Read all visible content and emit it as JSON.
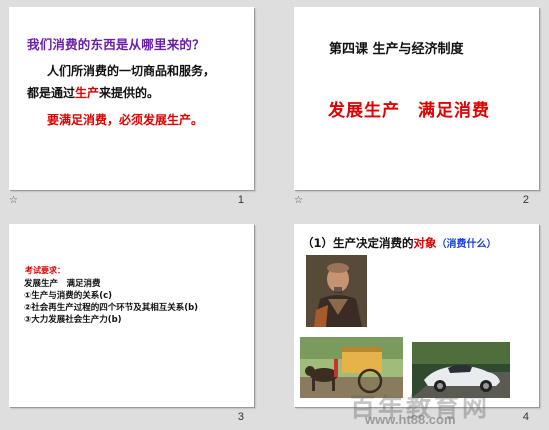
{
  "slides": [
    {
      "number": "1",
      "question": "我们消费的东西是从哪里来的？",
      "para1": "人们所消费的一切商品和服务，",
      "para2_a": "都是通过",
      "para2_red": "生产",
      "para2_b": "来提供的。",
      "para3": "要满足消费，必须发展生产。"
    },
    {
      "number": "2",
      "title": "第四课 生产与经济制度",
      "big_left": "发展生产",
      "big_right": "满足消费"
    },
    {
      "number": "3",
      "requirement_label": "考试要求：",
      "lines": [
        "发展生产　满足消费",
        "①生产与消费的关系(c)",
        "②社会再生产过程的四个环节及其相互关系(b)",
        "③大力发展社会生产力(b)"
      ]
    },
    {
      "number": "4",
      "heading_a": "（1）生产决定消费的",
      "heading_red": "对象",
      "heading_blue": "（消费什么）"
    }
  ],
  "icons": {
    "slide_transition": "star-icon"
  },
  "watermark": {
    "text": "百年教育网",
    "url": "www.ht88.com"
  }
}
